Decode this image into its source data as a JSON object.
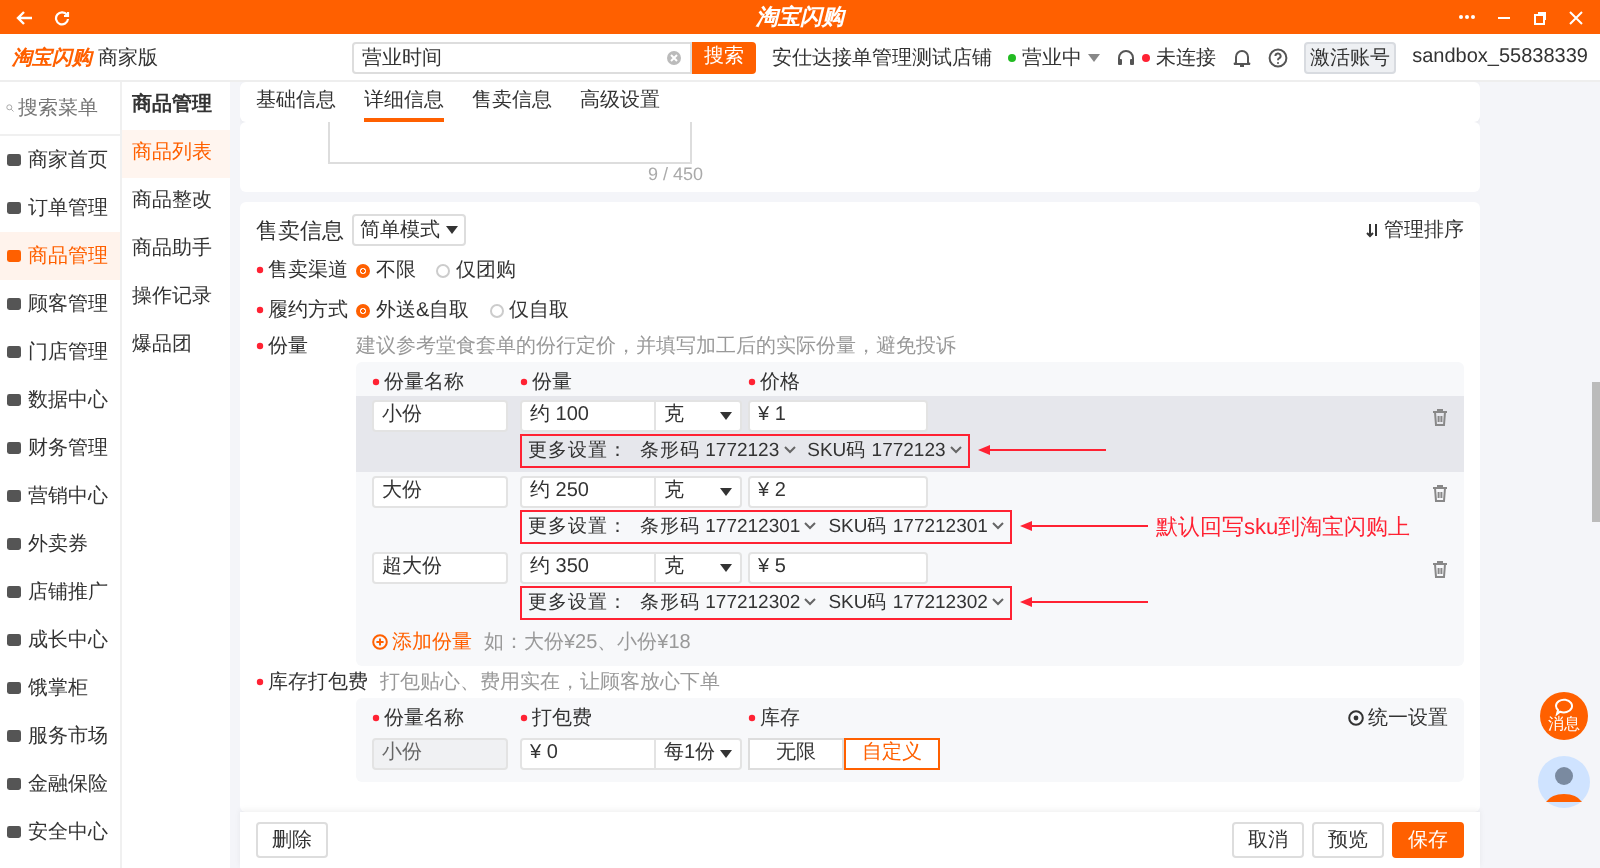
{
  "title_bar": {
    "title": "淘宝闪购"
  },
  "header": {
    "logo": "淘宝闪购",
    "edition": "商家版",
    "search": {
      "value": "营业时间"
    },
    "search_button": "搜索",
    "store_name": "安仕达接单管理测试店铺",
    "business_status": "营业中",
    "connection": "未连接",
    "account_badge": "激活账号",
    "account": "sandbox_55838339"
  },
  "sidebar": {
    "search": {
      "placeholder": "搜索菜单"
    },
    "items": [
      {
        "label": "商家首页",
        "selected": false
      },
      {
        "label": "订单管理",
        "selected": false
      },
      {
        "label": "商品管理",
        "selected": true
      },
      {
        "label": "顾客管理",
        "selected": false
      },
      {
        "label": "门店管理",
        "selected": false
      },
      {
        "label": "数据中心",
        "selected": false
      },
      {
        "label": "财务管理",
        "selected": false
      },
      {
        "label": "营销中心",
        "selected": false
      },
      {
        "label": "外卖券",
        "selected": false
      },
      {
        "label": "店铺推广",
        "selected": false
      },
      {
        "label": "成长中心",
        "selected": false
      },
      {
        "label": "饿掌柜",
        "selected": false
      },
      {
        "label": "服务市场",
        "selected": false
      },
      {
        "label": "金融保险",
        "selected": false
      },
      {
        "label": "安全中心",
        "selected": false
      }
    ]
  },
  "submenu": {
    "title": "商品管理",
    "items": [
      {
        "label": "商品列表",
        "selected": true
      },
      {
        "label": "商品整改",
        "selected": false
      },
      {
        "label": "商品助手",
        "selected": false
      },
      {
        "label": "操作记录",
        "selected": false
      },
      {
        "label": "爆品团",
        "selected": false
      }
    ]
  },
  "tabs": [
    {
      "label": "基础信息",
      "selected": false
    },
    {
      "label": "详细信息",
      "selected": true
    },
    {
      "label": "售卖信息",
      "selected": false
    },
    {
      "label": "高级设置",
      "selected": false
    }
  ],
  "description": {
    "counter": "9 / 450"
  },
  "sales": {
    "title": "售卖信息",
    "mode": "简单模式",
    "sort_link": "管理排序",
    "fields": [
      {
        "kind": "radio",
        "label": "售卖渠道",
        "options": [
          {
            "label": "不限",
            "selected": true
          },
          {
            "label": "仅团购",
            "selected": false
          }
        ]
      },
      {
        "kind": "radio",
        "label": "履约方式",
        "options": [
          {
            "label": "外送&自取",
            "selected": true
          },
          {
            "label": "仅自取",
            "selected": false
          }
        ]
      },
      {
        "kind": "specs",
        "label": "份量",
        "hint": "建议参考堂食套单的份行定价，并填写加工后的实际份量，避免投诉",
        "columns": [
          "份量名称",
          "份量",
          "价格"
        ],
        "rows": [
          {
            "name": "小份",
            "amount": "约 100",
            "unit": "克",
            "price": "¥ 1",
            "more_label": "更多设置：",
            "barcode": "条形码 1772123",
            "sku": "SKU码 1772123",
            "hovered": true,
            "boxed": true
          },
          {
            "name": "大份",
            "amount": "约 250",
            "unit": "克",
            "price": "¥ 2",
            "more_label": "更多设置：",
            "barcode": "条形码 177212301",
            "sku": "SKU码 177212301",
            "hovered": false,
            "boxed": true,
            "note": "默认回写sku到淘宝闪购上"
          },
          {
            "name": "超大份",
            "amount": "约 350",
            "unit": "克",
            "price": "¥ 5",
            "more_label": "更多设置：",
            "barcode": "条形码 177212302",
            "sku": "SKU码 177212302",
            "hovered": false,
            "boxed": true
          }
        ],
        "add_link": "添加份量",
        "add_hint": "如：大份¥25、小份¥18"
      },
      {
        "kind": "packing",
        "label": "库存打包费",
        "hint": "打包贴心、费用实在，让顾客放心下单",
        "columns": [
          "份量名称",
          "打包费",
          "库存"
        ],
        "unify": "统一设置",
        "rows": [
          {
            "name": "小份",
            "fee": "¥ 0",
            "per": "每1份",
            "stock_options": [
              {
                "label": "无限",
                "selected": false
              },
              {
                "label": "自定义",
                "selected": true
              }
            ]
          }
        ]
      }
    ]
  },
  "footer": {
    "delete": "删除",
    "cancel": "取消",
    "preview": "预览",
    "save": "保存"
  },
  "float": {
    "message": "消息"
  }
}
